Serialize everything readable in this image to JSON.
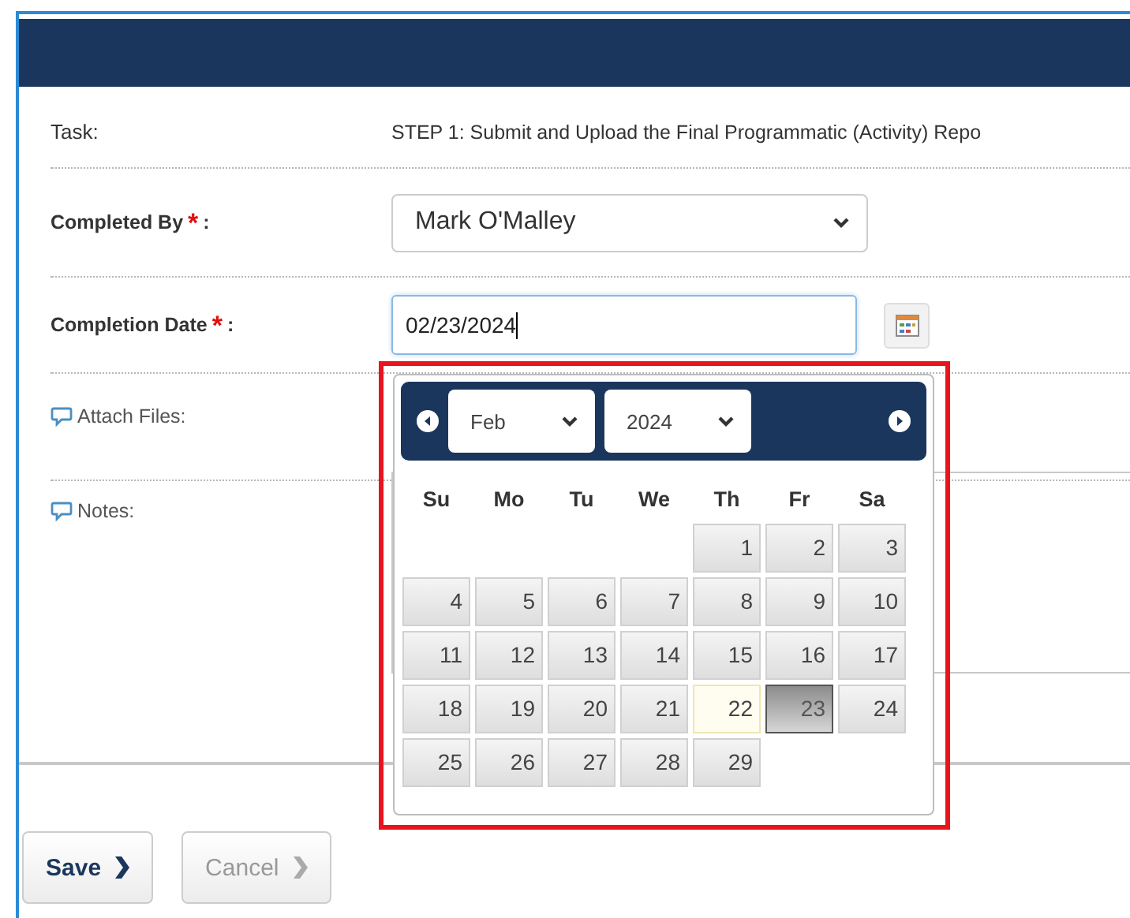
{
  "form": {
    "rows": [
      {
        "kind": "text",
        "label": "Task:",
        "value": "STEP 1: Submit and Upload the Final Programmatic (Activity) Repo"
      },
      {
        "kind": "select",
        "label": "Completed By",
        "required_mark": "*",
        "suffix": ":",
        "value": "Mark O'Malley"
      },
      {
        "kind": "date",
        "label": "Completion Date",
        "required_mark": "*",
        "suffix": ":",
        "value": "02/23/2024"
      },
      {
        "kind": "files",
        "label": "Attach Files:",
        "help": true
      },
      {
        "kind": "notes",
        "label": "Notes:",
        "help": true
      }
    ]
  },
  "datepicker": {
    "month": "Feb",
    "year": "2024",
    "weekdays": [
      "Su",
      "Mo",
      "Tu",
      "We",
      "Th",
      "Fr",
      "Sa"
    ],
    "days": [
      {
        "kind": "blank"
      },
      {
        "kind": "blank"
      },
      {
        "kind": "blank"
      },
      {
        "kind": "blank"
      },
      {
        "kind": "day",
        "label": "1",
        "selected": false,
        "today": false
      },
      {
        "kind": "day",
        "label": "2",
        "selected": false,
        "today": false
      },
      {
        "kind": "day",
        "label": "3",
        "selected": false,
        "today": false
      },
      {
        "kind": "day",
        "label": "4",
        "selected": false,
        "today": false
      },
      {
        "kind": "day",
        "label": "5",
        "selected": false,
        "today": false
      },
      {
        "kind": "day",
        "label": "6",
        "selected": false,
        "today": false
      },
      {
        "kind": "day",
        "label": "7",
        "selected": false,
        "today": false
      },
      {
        "kind": "day",
        "label": "8",
        "selected": false,
        "today": false
      },
      {
        "kind": "day",
        "label": "9",
        "selected": false,
        "today": false
      },
      {
        "kind": "day",
        "label": "10",
        "selected": false,
        "today": false
      },
      {
        "kind": "day",
        "label": "11",
        "selected": false,
        "today": false
      },
      {
        "kind": "day",
        "label": "12",
        "selected": false,
        "today": false
      },
      {
        "kind": "day",
        "label": "13",
        "selected": false,
        "today": false
      },
      {
        "kind": "day",
        "label": "14",
        "selected": false,
        "today": false
      },
      {
        "kind": "day",
        "label": "15",
        "selected": false,
        "today": false
      },
      {
        "kind": "day",
        "label": "16",
        "selected": false,
        "today": false
      },
      {
        "kind": "day",
        "label": "17",
        "selected": false,
        "today": false
      },
      {
        "kind": "day",
        "label": "18",
        "selected": false,
        "today": false
      },
      {
        "kind": "day",
        "label": "19",
        "selected": false,
        "today": false
      },
      {
        "kind": "day",
        "label": "20",
        "selected": false,
        "today": false
      },
      {
        "kind": "day",
        "label": "21",
        "selected": false,
        "today": false
      },
      {
        "kind": "day",
        "label": "22",
        "selected": false,
        "today": true
      },
      {
        "kind": "day",
        "label": "23",
        "selected": true,
        "today": false
      },
      {
        "kind": "day",
        "label": "24",
        "selected": false,
        "today": false
      },
      {
        "kind": "day",
        "label": "25",
        "selected": false,
        "today": false
      },
      {
        "kind": "day",
        "label": "26",
        "selected": false,
        "today": false
      },
      {
        "kind": "day",
        "label": "27",
        "selected": false,
        "today": false
      },
      {
        "kind": "day",
        "label": "28",
        "selected": false,
        "today": false
      },
      {
        "kind": "day",
        "label": "29",
        "selected": false,
        "today": false
      }
    ]
  },
  "buttons": [
    {
      "label": "Save",
      "disabled": false
    },
    {
      "label": "Cancel",
      "disabled": true
    }
  ]
}
